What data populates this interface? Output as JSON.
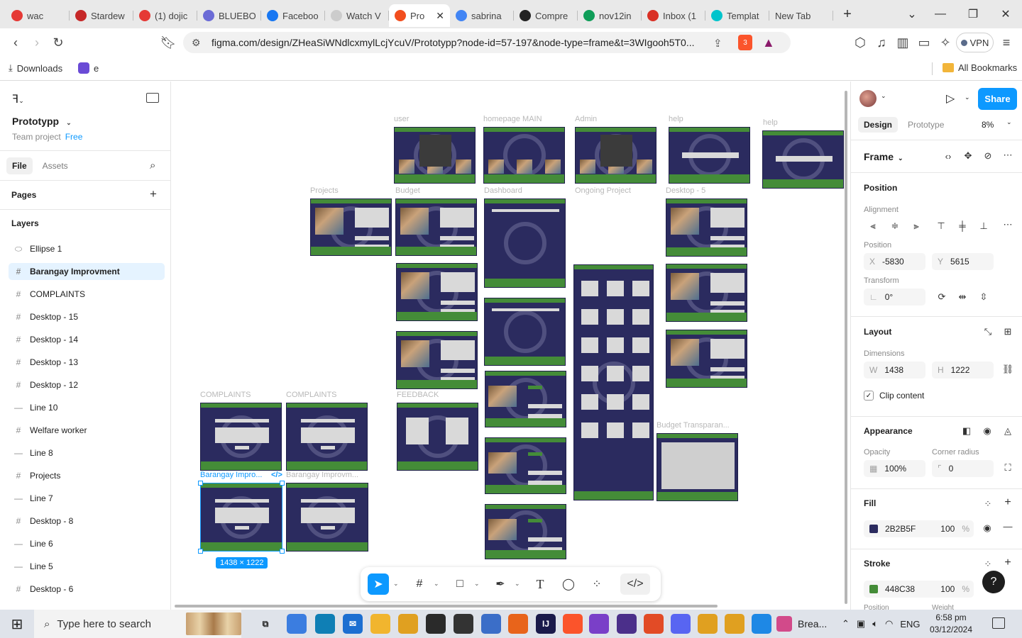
{
  "browser": {
    "tabs": [
      {
        "label": "wac",
        "icon": "youtube-audio-icon",
        "color": "#e53935"
      },
      {
        "label": "Stardew",
        "icon": "pinterest-icon",
        "color": "#c62828"
      },
      {
        "label": "(1) dojic",
        "icon": "youtube-icon",
        "color": "#e53935"
      },
      {
        "label": "BLUEBO",
        "icon": "site-icon",
        "color": "#6b6bd6"
      },
      {
        "label": "Faceboo",
        "icon": "facebook-icon",
        "color": "#1877f2"
      },
      {
        "label": "Watch V",
        "icon": "page-icon",
        "color": "#cccccc"
      },
      {
        "label": "Pro",
        "icon": "figma-icon",
        "color": "#f24e1e",
        "active": true
      },
      {
        "label": "sabrina",
        "icon": "google-icon",
        "color": "#4285f4"
      },
      {
        "label": "Compre",
        "icon": "ez-icon",
        "color": "#222222"
      },
      {
        "label": "nov12in",
        "icon": "drive-icon",
        "color": "#0f9d58"
      },
      {
        "label": "Inbox (1",
        "icon": "gmail-icon",
        "color": "#d93025"
      },
      {
        "label": "Templat",
        "icon": "canva-icon",
        "color": "#00c4cc"
      }
    ],
    "new_tab_label": "New Tab",
    "url": "figma.com/design/ZHeaSiWNdlcxmylLcjYcuV/Prototypp?node-id=57-197&node-type=frame&t=3WIgooh5T0...",
    "vpn_label": "VPN",
    "brave_badge": "3",
    "bookmarks": {
      "downloads": "Downloads",
      "item2": "e",
      "all": "All Bookmarks"
    }
  },
  "figma": {
    "project_name": "Prototypp",
    "team": "Team project",
    "plan": "Free",
    "left_tabs": [
      "File",
      "Assets"
    ],
    "pages_label": "Pages",
    "layers_label": "Layers",
    "layers": [
      {
        "name": "Ellipse 1",
        "type": "ellipse"
      },
      {
        "name": "Barangay Improvment",
        "type": "frame",
        "selected": true
      },
      {
        "name": "COMPLAINTS",
        "type": "frame"
      },
      {
        "name": "Desktop - 15",
        "type": "frame"
      },
      {
        "name": "Desktop - 14",
        "type": "frame"
      },
      {
        "name": "Desktop - 13",
        "type": "frame"
      },
      {
        "name": "Desktop - 12",
        "type": "frame"
      },
      {
        "name": "Line 10",
        "type": "line"
      },
      {
        "name": "Welfare worker",
        "type": "frame"
      },
      {
        "name": "Line 8",
        "type": "line"
      },
      {
        "name": "Projects",
        "type": "frame"
      },
      {
        "name": "Line 7",
        "type": "line"
      },
      {
        "name": "Desktop - 8",
        "type": "frame"
      },
      {
        "name": "Line 6",
        "type": "line"
      },
      {
        "name": "Line 5",
        "type": "line"
      },
      {
        "name": "Desktop - 6",
        "type": "frame"
      }
    ],
    "canvas_labels": {
      "user": "user",
      "homepage": "homepage MAIN",
      "admin": "Admin",
      "help1": "help",
      "help2": "help",
      "projects": "Projects",
      "budget": "Budget",
      "dashboard": "Dashboard",
      "ongoing": "Ongoing Project",
      "desktop5": "Desktop - 5",
      "complaints1": "COMPLAINTS",
      "complaints2": "COMPLAINTS",
      "feedback": "FEEDBACK",
      "barangay_sel": "Barangay Impro...",
      "barangay2": "Barangay Improvm...",
      "budget_transp": "Budget Transparan..."
    },
    "selection_size": "1438 × 1222",
    "right": {
      "tabs": [
        "Design",
        "Prototype"
      ],
      "zoom": "8%",
      "share": "Share",
      "frame_label": "Frame",
      "position_h": "Position",
      "alignment_label": "Alignment",
      "position_label": "Position",
      "x_label": "X",
      "x_value": "-5830",
      "y_label": "Y",
      "y_value": "5615",
      "transform_label": "Transform",
      "rotation": "0°",
      "layout_h": "Layout",
      "dimensions_label": "Dimensions",
      "w_label": "W",
      "w_value": "1438",
      "h_label": "H",
      "h_value": "1222",
      "clip_content": "Clip content",
      "appearance_h": "Appearance",
      "opacity_label": "Opacity",
      "opacity_value": "100%",
      "radius_label": "Corner radius",
      "radius_value": "0",
      "fill_h": "Fill",
      "fill_hex": "2B2B5F",
      "fill_opacity": "100",
      "fill_color": "#2b2b5f",
      "stroke_h": "Stroke",
      "stroke_hex": "448C38",
      "stroke_opacity": "100",
      "stroke_color": "#448c38",
      "percent": "%",
      "position_cut": "Position",
      "weight_cut": "Weight"
    }
  },
  "taskbar": {
    "search_placeholder": "Type here to search",
    "active_app": "Brea...",
    "lang": "ENG",
    "time": "6:58 pm",
    "date": "03/12/2024"
  }
}
